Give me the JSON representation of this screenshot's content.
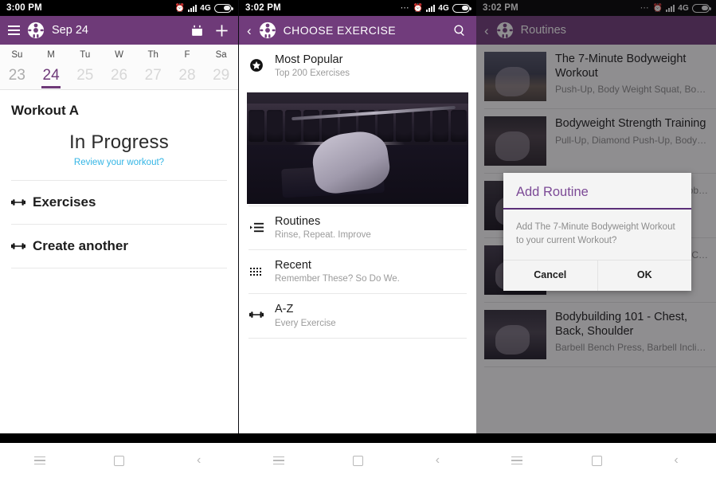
{
  "panel1": {
    "statusbar": {
      "time": "3:00 PM",
      "network": "4G",
      "icons": [
        "alarm-clock-icon",
        "signal-bars-icon",
        "battery-icon"
      ]
    },
    "appbar": {
      "title": "Sep 24",
      "menu_icon": "hamburger-menu-icon",
      "logo_icon": "app-logo-icon",
      "calendar_icon": "calendar-icon",
      "add_icon": "plus-icon"
    },
    "calendar": {
      "dow": [
        "Su",
        "M",
        "Tu",
        "W",
        "Th",
        "F",
        "Sa"
      ],
      "days": [
        "23",
        "24",
        "25",
        "26",
        "27",
        "28",
        "29"
      ],
      "selected_index": 1
    },
    "workout_title": "Workout A",
    "status_text": "In Progress",
    "review_link": "Review your workout?",
    "rows": [
      {
        "label": "Exercises",
        "icon": "dumbbell-icon"
      },
      {
        "label": "Create another",
        "icon": "dumbbell-icon"
      }
    ]
  },
  "panel2": {
    "statusbar": {
      "time": "3:02 PM",
      "network": "4G"
    },
    "appbar": {
      "title": "CHOOSE EXERCISE",
      "back_icon": "back-chevron-icon",
      "logo_icon": "app-logo-icon",
      "search_icon": "search-icon"
    },
    "options": [
      {
        "title": "Most Popular",
        "subtitle": "Top 200 Exercises",
        "icon": "star-circle-icon"
      },
      {
        "title": "Routines",
        "subtitle": "Rinse, Repeat. Improve",
        "icon": "list-icon"
      },
      {
        "title": "Recent",
        "subtitle": "Remember These? So Do We.",
        "icon": "grid-dots-icon"
      },
      {
        "title": "A-Z",
        "subtitle": "Every Exercise",
        "icon": "dumbbell-icon"
      }
    ],
    "hero_image_alt": "bench-press-photo"
  },
  "panel3": {
    "statusbar": {
      "time": "3:02 PM",
      "network": "4G"
    },
    "appbar": {
      "title": "Routines",
      "back_icon": "back-chevron-icon",
      "logo_icon": "app-logo-icon"
    },
    "routines": [
      {
        "title": "The 7-Minute Bodyweight Workout",
        "subtitle": "Push-Up, Body Weight Squat, Body Weigh…"
      },
      {
        "title": "Bodyweight Strength Training",
        "subtitle": "Pull-Up, Diamond Push-Up, Body Weight…"
      },
      {
        "title": "",
        "subtitle": "…bb…"
      },
      {
        "title": "",
        "subtitle": "…ell C…"
      },
      {
        "title": "Bodybuilding 101 - Chest, Back, Shoulder",
        "subtitle": "Barbell Bench Press, Barbell Incline Benc…"
      }
    ],
    "dialog": {
      "title": "Add Routine",
      "message": "Add The 7-Minute Bodyweight Workout to your current Workout?",
      "cancel_label": "Cancel",
      "ok_label": "OK"
    }
  },
  "navbar": {
    "menu_icon": "nav-menu-icon",
    "home_icon": "nav-home-icon",
    "back_icon": "nav-back-icon"
  },
  "colors": {
    "appbar_purple": "#6e3a78",
    "accent_link": "#33b5e5",
    "dialog_title": "#7c4a96",
    "dialog_rule": "#5b2f78"
  }
}
